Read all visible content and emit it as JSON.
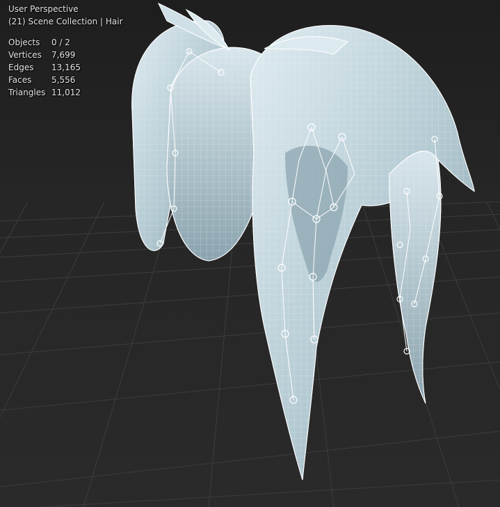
{
  "viewport": {
    "view_name": "User Perspective",
    "collection": "(21) Scene Collection | Hair"
  },
  "stats": [
    {
      "label": "Objects",
      "value": "0 / 2"
    },
    {
      "label": "Vertices",
      "value": "7,699"
    },
    {
      "label": "Edges",
      "value": "13,165"
    },
    {
      "label": "Faces",
      "value": "5,556"
    },
    {
      "label": "Triangles",
      "value": "11,012"
    }
  ],
  "colors": {
    "background": "#262626",
    "grid_line": "#3c3c3c",
    "hair_fill": "#b9cfd8",
    "hair_shadow": "#7f9aa6",
    "wire": "#ffffff"
  }
}
